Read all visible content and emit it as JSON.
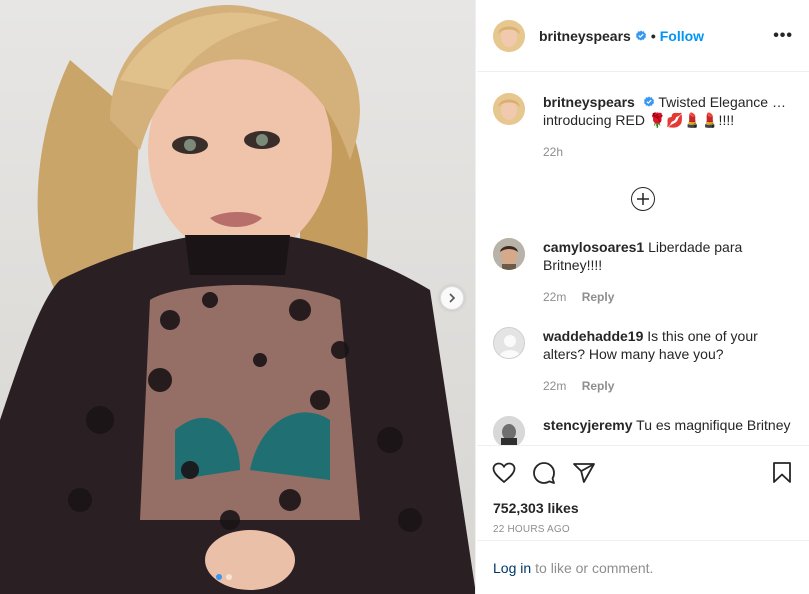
{
  "post": {
    "username": "britneyspears",
    "follow_label": "Follow",
    "separator": "•",
    "more_label": "•••",
    "carousel": {
      "slides": 2,
      "active_index": 0
    }
  },
  "caption": {
    "username": "britneyspears",
    "text": "Twisted Elegance … introducing RED 🌹💋💄💄!!!!",
    "time": "22h"
  },
  "comments": [
    {
      "username": "camylosoares1",
      "text": "Liberdade para Britney!!!!",
      "time": "22m",
      "reply_label": "Reply"
    },
    {
      "username": "waddehadde19",
      "text": "Is this one of your alters? How many have you?",
      "time": "22m",
      "reply_label": "Reply"
    },
    {
      "username": "stencyjeremy",
      "text": "Tu es magnifique Britney"
    }
  ],
  "stats": {
    "likes": "752,303 likes",
    "posted": "22 HOURS AGO"
  },
  "login": {
    "link": "Log in",
    "rest": "to like or comment."
  },
  "colors": {
    "accent": "#0095f6",
    "verified": "#3897f0",
    "muted": "#8e8e8e"
  },
  "icons": [
    "verified-badge-icon",
    "more-options-icon",
    "add-circle-icon",
    "heart-icon",
    "comment-icon",
    "share-icon",
    "bookmark-icon",
    "chevron-right-icon"
  ]
}
